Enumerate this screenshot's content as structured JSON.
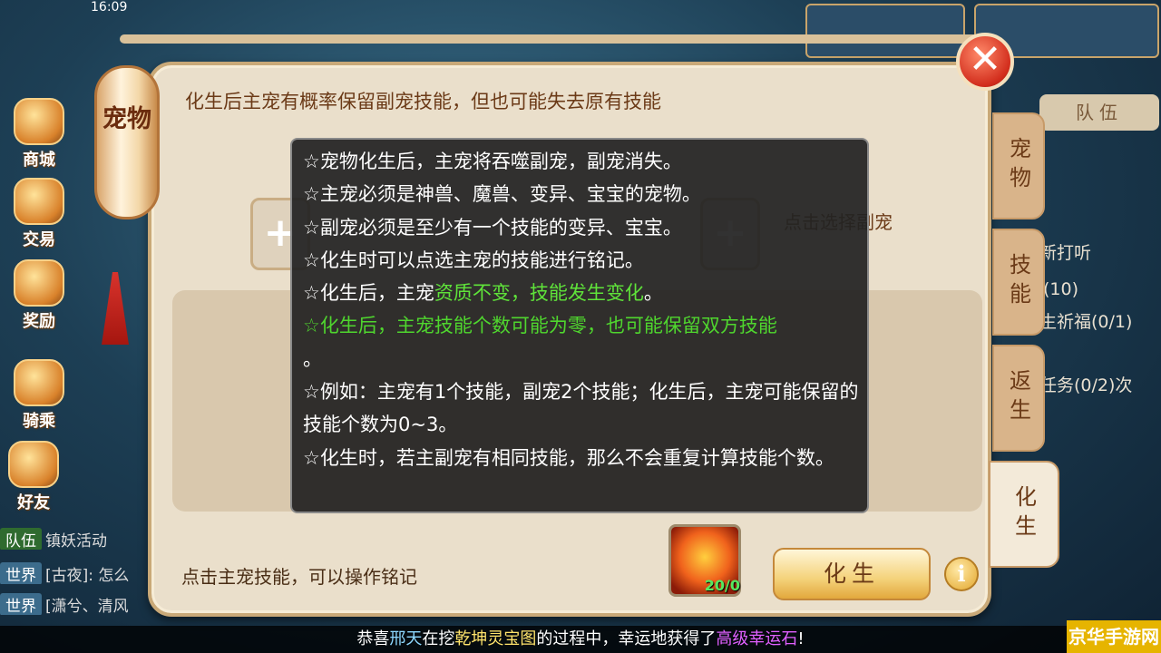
{
  "status_time": "16:09",
  "left_menu": [
    {
      "label": "商城"
    },
    {
      "label": "交易"
    },
    {
      "label": "奖励"
    },
    {
      "label": "骑乘"
    },
    {
      "label": "好友"
    }
  ],
  "chat": [
    {
      "tag": "队伍",
      "text": "镇妖活动"
    },
    {
      "tag": "世界",
      "text": "[古夜]: 怎么"
    },
    {
      "tag": "世界",
      "text": "[潇兮、清风"
    }
  ],
  "right_fragments": {
    "team_button": "队伍",
    "line1": "新打听",
    "line2": "(10)",
    "line3": "生祈福(0/1)",
    "line4": "任务(0/2)次"
  },
  "panel": {
    "lantern_text": "宠物",
    "title": "化生后主宠有概率保留副宠技能，但也可能失去原有技能",
    "select_sub_pet": "点击选择副宠",
    "bottom_hint": "点击主宠技能，可以操作铭记",
    "rebirth_button": "化生",
    "item_count": "20/0",
    "tabs": [
      {
        "label": "宠物",
        "active": false
      },
      {
        "label": "技能",
        "active": false
      },
      {
        "label": "返生",
        "active": false
      },
      {
        "label": "化生",
        "active": true
      }
    ]
  },
  "tooltip": {
    "l1": "☆宠物化生后，主宠将吞噬副宠，副宠消失。",
    "l2": "☆主宠必须是神兽、魔兽、变异、宝宝的宠物。",
    "l3": "☆副宠必须是至少有一个技能的变异、宝宝。",
    "l4": "☆化生时可以点选主宠的技能进行铭记。",
    "l5a": "☆化生后，主宠",
    "l5b": "资质不变，技能发生变化",
    "l5c": "。",
    "l6": "☆化生后，主宠技能个数可能为零，也可能保留双方技能",
    "l6end": "。",
    "l7": "☆例如：主宠有1个技能，副宠2个技能；化生后，主宠可能保留的技能个数为0~3。",
    "l8": "☆化生时，若主副宠有相同技能，那么不会重复计算技能个数。"
  },
  "broadcast": {
    "pre": "恭喜",
    "player": "邢天",
    "mid1": "在挖",
    "map": "乾坤灵宝图",
    "mid2": "的过程中，幸运地获得了",
    "item": "高级幸运石",
    "end": "!"
  },
  "watermark": "京华手游网",
  "colors": {
    "panel_bg": "#eadfcb",
    "tooltip_bg": "#222222",
    "highlight_green": "#5fe33a",
    "title_brown": "#6b3a17"
  }
}
